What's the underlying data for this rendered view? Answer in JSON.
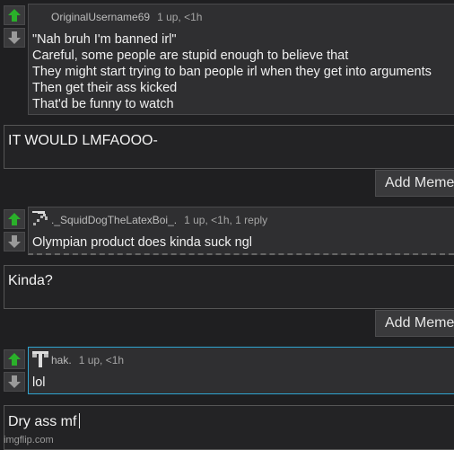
{
  "colors": {
    "upvote_active": "#2ab02a",
    "arrow_inactive": "#9a9a9a",
    "highlight_border": "#2fa4d0"
  },
  "comments": [
    {
      "username": "OriginalUsername69",
      "stats": "1 up, <1h",
      "upvoted": true,
      "lines": [
        "\"Nah bruh I'm banned irl\"",
        "Careful, some people are stupid enough to believe that",
        "They might start trying to ban people irl when they get into arguments",
        "Then get their ass kicked",
        "That'd be funny to watch"
      ]
    },
    {
      "username": "._SquidDogTheLatexBoi_.",
      "stats": "1 up, <1h, 1 reply",
      "upvoted": true,
      "lines": [
        "Olympian product does kinda suck ngl"
      ]
    },
    {
      "username": "hak.",
      "stats": "1 up, <1h",
      "upvoted": true,
      "lines": [
        "lol"
      ]
    }
  ],
  "replies": [
    {
      "text": "IT WOULD LMFAOOO-"
    },
    {
      "text": "Kinda?"
    },
    {
      "text": "Dry ass mf"
    }
  ],
  "add_meme_label": "Add Meme",
  "watermark": "imgflip.com"
}
